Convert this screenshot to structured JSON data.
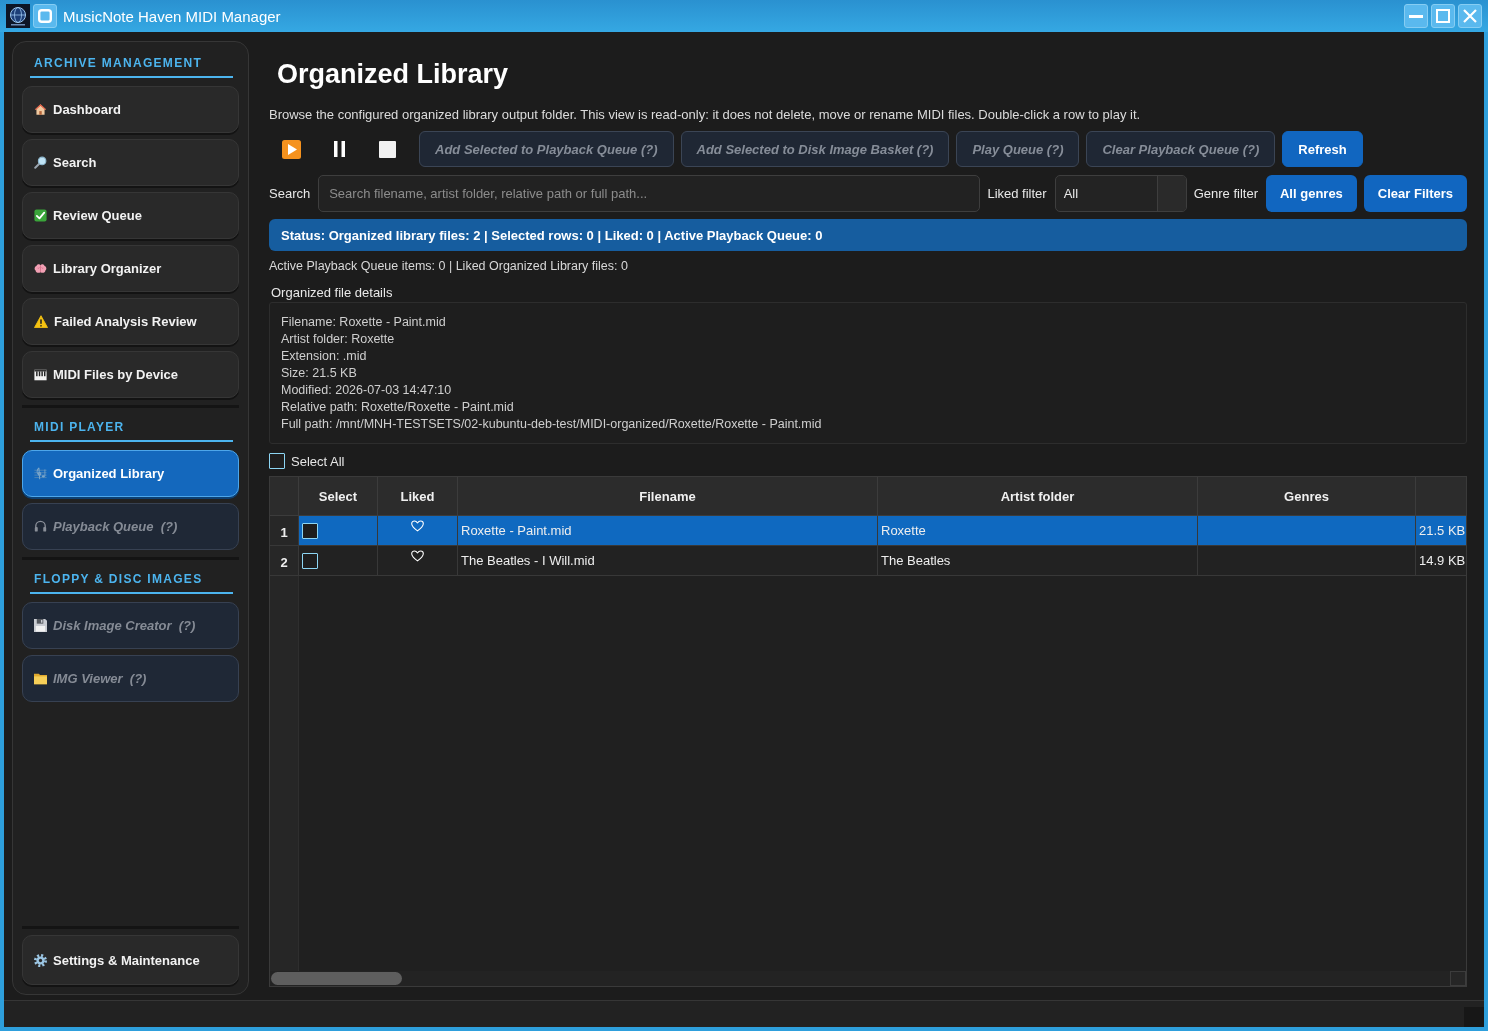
{
  "window": {
    "title": "MusicNote Haven MIDI Manager"
  },
  "sidebar": {
    "sections": [
      {
        "title": "ARCHIVE MANAGEMENT",
        "items": [
          {
            "label": "Dashboard",
            "selected": false,
            "disabled": false
          },
          {
            "label": "Search",
            "selected": false,
            "disabled": false
          },
          {
            "label": "Review Queue",
            "selected": false,
            "disabled": false
          },
          {
            "label": "Library Organizer",
            "selected": false,
            "disabled": false
          },
          {
            "label": "Failed Analysis Review",
            "selected": false,
            "disabled": false
          },
          {
            "label": "MIDI Files by Device",
            "selected": false,
            "disabled": false
          }
        ]
      },
      {
        "title": "MIDI PLAYER",
        "items": [
          {
            "label": "Organized Library",
            "selected": true,
            "disabled": false
          },
          {
            "label": "Playback Queue  (?)",
            "selected": false,
            "disabled": true
          }
        ]
      },
      {
        "title": "FLOPPY & DISC IMAGES",
        "items": [
          {
            "label": "Disk Image Creator  (?)",
            "selected": false,
            "disabled": true
          },
          {
            "label": "IMG Viewer  (?)",
            "selected": false,
            "disabled": true
          }
        ]
      }
    ],
    "footer_item": {
      "label": "Settings & Maintenance",
      "selected": false,
      "disabled": false
    }
  },
  "main": {
    "title": "Organized Library",
    "description": "Browse the configured organized library output folder. This view is read-only: it does not delete, move or rename MIDI files. Double-click a row to play it.",
    "actions": [
      {
        "label": "Add Selected to Playback Queue (?)",
        "disabled": true
      },
      {
        "label": "Add Selected to Disk Image Basket (?)",
        "disabled": true
      },
      {
        "label": "Play Queue (?)",
        "disabled": true
      },
      {
        "label": "Clear Playback Queue (?)",
        "disabled": true
      },
      {
        "label": "Refresh",
        "disabled": false
      }
    ],
    "search": {
      "label": "Search",
      "placeholder": "Search filename, artist folder, relative path or full path..."
    },
    "liked_filter": {
      "label": "Liked filter",
      "value": "All"
    },
    "genre_filter": {
      "label": "Genre filter",
      "value": "All genres"
    },
    "clear_filters_button": "Clear Filters",
    "status_banner": "Status: Organized library files: 2 | Selected rows: 0 | Liked: 0 | Active Playback Queue: 0",
    "counts": "Active Playback Queue items: 0 | Liked Organized Library files: 0",
    "details": {
      "title": "Organized file details",
      "lines": [
        "Filename: Roxette - Paint.mid",
        "Artist folder: Roxette",
        "Extension: .mid",
        "Size: 21.5 KB",
        "Modified: 2026-07-03 14:47:10",
        "Relative path: Roxette/Roxette - Paint.mid",
        "Full path: /mnt/MNH-TESTSETS/02-kubuntu-deb-test/MIDI-organized/Roxette/Roxette - Paint.mid"
      ]
    },
    "select_all": {
      "label": "Select All",
      "checked": false
    },
    "table": {
      "columns": [
        "Select",
        "Liked",
        "Filename",
        "Artist folder",
        "Genres"
      ],
      "rows": [
        {
          "number": "1",
          "selected": true,
          "checked": false,
          "liked": false,
          "filename": "Roxette - Paint.mid",
          "artist_folder": "Roxette",
          "column_6": "21.5 KB"
        },
        {
          "number": "2",
          "selected": false,
          "checked": false,
          "liked": false,
          "filename": "The Beatles - I Will.mid",
          "artist_folder": "The Beatles",
          "column_6": "14.9 KB"
        }
      ]
    }
  }
}
